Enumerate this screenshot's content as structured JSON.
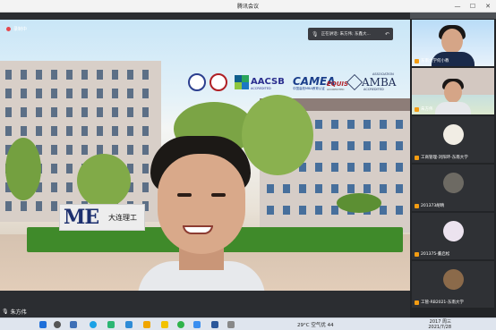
{
  "window": {
    "title": "腾讯会议",
    "controls": [
      "—",
      "☐",
      "✕"
    ]
  },
  "recording": {
    "label": "录制中"
  },
  "speaking": {
    "label": "正在讲话: 朱方伟; 东鑫大..."
  },
  "stage": {
    "logos": {
      "aacsb": "AACSB",
      "aacsb_sub": "ACCREDITED",
      "camea": "CAMEA",
      "camea_sub": "中国高校MBA教育认证",
      "equis": "EQUIS",
      "equis_sub": "ACCREDITED",
      "amba": "AMBA",
      "amba_top": "ASSOCIATION",
      "amba_bottom": "ACCREDITED"
    },
    "sign": {
      "big": "ME",
      "small": "大连理工"
    },
    "speaker_name": "朱方伟"
  },
  "participants": [
    {
      "name": "东南大学何小教",
      "kind": "video"
    },
    {
      "name": "朱方伟",
      "kind": "video"
    },
    {
      "name": "工商管理-刘阳环-东南大学",
      "kind": "avatar",
      "color": "#f1ede4"
    },
    {
      "name": "201373胡晴",
      "kind": "avatar",
      "color": "#6d6a63"
    },
    {
      "name": "201375-董启松",
      "kind": "avatar",
      "color": "#ece3ef"
    },
    {
      "name": "工管-RB2021-东南大学",
      "kind": "avatar",
      "color": "#8b6a4a"
    }
  ],
  "taskbar": {
    "weather": "29°C 空气优 44",
    "time": "2017 周三",
    "date": "2021/7/28"
  }
}
